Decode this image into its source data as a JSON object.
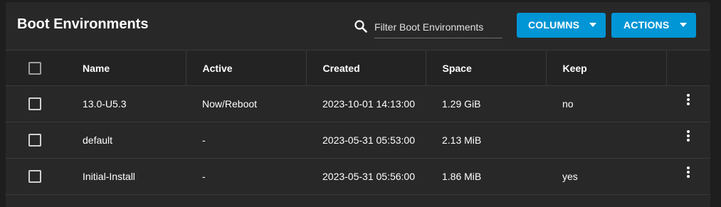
{
  "header": {
    "title": "Boot Environments",
    "search_placeholder": "Filter Boot Environments",
    "search_value": "",
    "columns_button": "COLUMNS",
    "actions_button": "ACTIONS"
  },
  "table": {
    "columns": [
      "Name",
      "Active",
      "Created",
      "Space",
      "Keep"
    ],
    "rows": [
      {
        "name": "13.0-U5.3",
        "active": "Now/Reboot",
        "created": "2023-10-01 14:13:00",
        "space": "1.29 GiB",
        "keep": "no"
      },
      {
        "name": "default",
        "active": "-",
        "created": "2023-05-31 05:53:00",
        "space": "2.13 MiB",
        "keep": ""
      },
      {
        "name": "Initial-Install",
        "active": "-",
        "created": "2023-05-31 05:56:00",
        "space": "1.86 MiB",
        "keep": "yes"
      }
    ]
  },
  "colors": {
    "page_background": "#1e1e1e",
    "card_background": "#282828",
    "accent_button": "#0095d5",
    "text": "#ffffff",
    "divider": "#3a3a3a"
  },
  "icons": {
    "search": "search-icon",
    "caret": "caret-down-icon",
    "row_menu": "more-vert-icon",
    "checkbox": "checkbox-icon"
  }
}
